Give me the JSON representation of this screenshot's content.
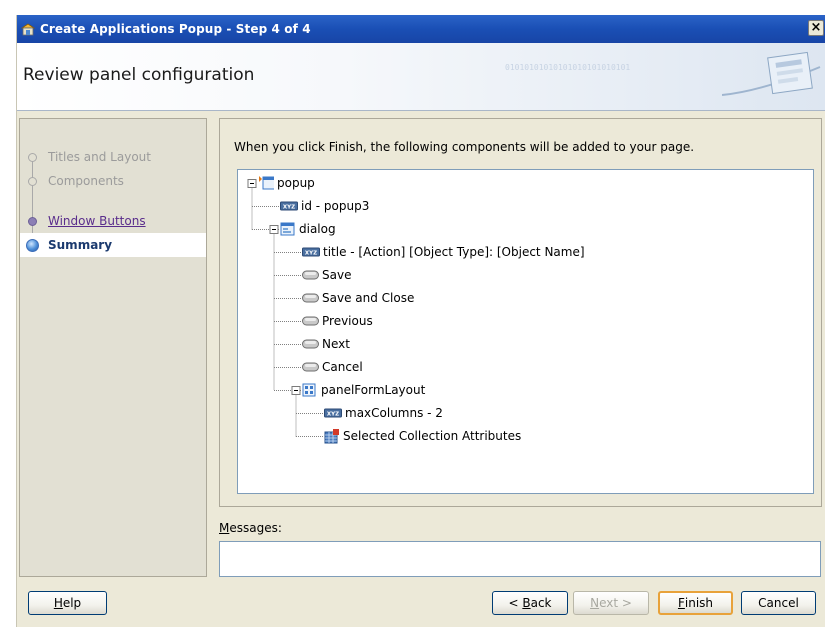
{
  "window": {
    "title": "Create Applications Popup - Step 4 of 4",
    "close_glyph": "×"
  },
  "header": {
    "title": "Review panel configuration",
    "binary_text": "01010101010101010101010101"
  },
  "nav": {
    "items": [
      {
        "label": "Titles and Layout",
        "state": "disabled"
      },
      {
        "label": "Components",
        "state": "disabled"
      },
      {
        "label": "Window Buttons",
        "state": "link"
      },
      {
        "label": "Summary",
        "state": "active"
      }
    ]
  },
  "content": {
    "intro": "When you click Finish, the following components will be added to your page."
  },
  "tree": [
    {
      "label": "popup",
      "icon": "popup-icon",
      "expanded": true
    },
    {
      "label": "id - popup3",
      "icon": "attribute-icon"
    },
    {
      "label": "dialog",
      "icon": "dialog-icon",
      "expanded": true
    },
    {
      "label": "title - [Action] [Object Type]: [Object Name]",
      "icon": "attribute-icon"
    },
    {
      "label": "Save",
      "icon": "button-icon"
    },
    {
      "label": "Save and Close",
      "icon": "button-icon"
    },
    {
      "label": "Previous",
      "icon": "button-icon"
    },
    {
      "label": "Next",
      "icon": "button-icon"
    },
    {
      "label": "Cancel",
      "icon": "button-icon"
    },
    {
      "label": "panelFormLayout",
      "icon": "form-layout-icon",
      "expanded": true
    },
    {
      "label": "maxColumns - 2",
      "icon": "attribute-icon"
    },
    {
      "label": "Selected Collection Attributes",
      "icon": "collection-icon"
    }
  ],
  "messages": {
    "label_mnemonic": "M",
    "label_rest": "essages:",
    "value": ""
  },
  "buttons": {
    "help": {
      "mnemonic": "H",
      "rest": "elp"
    },
    "back": {
      "prefix": "< ",
      "mnemonic": "B",
      "rest": "ack"
    },
    "next": {
      "mnemonic": "N",
      "rest": "ext >"
    },
    "finish": {
      "mnemonic": "F",
      "rest": "inish"
    },
    "cancel": {
      "label": "Cancel"
    }
  },
  "colors": {
    "titlebar": "#1a4fb5",
    "dialog_bg": "#ece9d8",
    "nav_bg": "#e2e0d3",
    "link": "#5a2d8c",
    "active_text": "#1b3a6e",
    "default_button_border": "#e8a23a"
  }
}
